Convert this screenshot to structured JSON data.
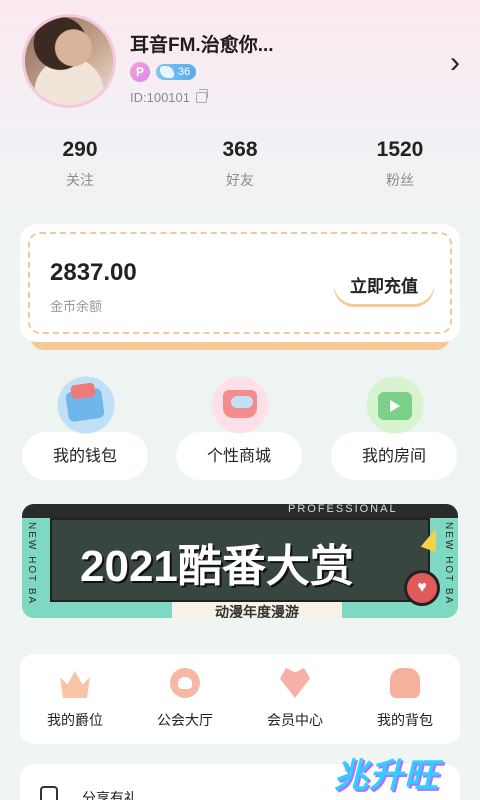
{
  "profile": {
    "nickname": "耳音FM.治愈你...",
    "badge_p": "P",
    "level": "36",
    "id_text": "ID:100101"
  },
  "stats": [
    {
      "value": "290",
      "label": "关注"
    },
    {
      "value": "368",
      "label": "好友"
    },
    {
      "value": "1520",
      "label": "粉丝"
    }
  ],
  "coins": {
    "amount": "2837.00",
    "label": "金币余额",
    "recharge_label": "立即充值"
  },
  "features": [
    {
      "label": "我的钱包",
      "icon": "wallet-icon"
    },
    {
      "label": "个性商城",
      "icon": "shop-icon"
    },
    {
      "label": "我的房间",
      "icon": "room-icon"
    }
  ],
  "banner": {
    "title": "2021酷番大赏",
    "subtitle": "动漫年度漫游",
    "top_text": "PROFESSIONAL",
    "side_left": "NEW HOT BA",
    "side_right": "NEW HOT BA"
  },
  "menu": [
    {
      "label": "我的爵位",
      "icon": "crown-icon"
    },
    {
      "label": "公会大厅",
      "icon": "guild-icon"
    },
    {
      "label": "会员中心",
      "icon": "vip-heart-icon"
    },
    {
      "label": "我的背包",
      "icon": "bag-icon"
    }
  ],
  "share": {
    "label": "分享有礼"
  },
  "watermark": "兆升旺"
}
